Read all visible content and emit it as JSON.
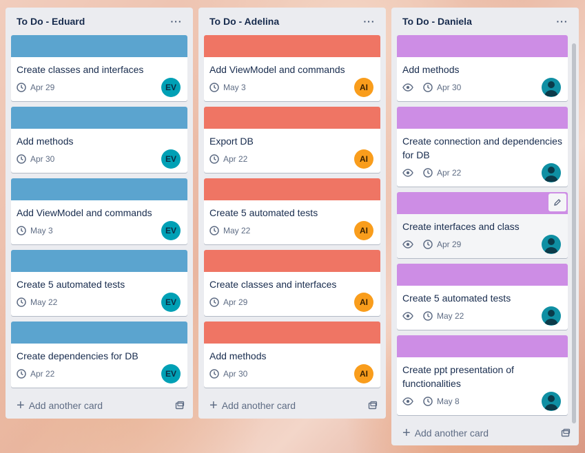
{
  "colors": {
    "blue": "#5ba4cf",
    "red": "#ef7564",
    "purple": "#cd8de5"
  },
  "lists": [
    {
      "title": "To Do - Eduard",
      "menu": "···",
      "add_card": "Add another card",
      "cards": [
        {
          "title": "Create classes and interfaces",
          "date": "Apr 29",
          "avatar": "EV"
        },
        {
          "title": "Add methods",
          "date": "Apr 30",
          "avatar": "EV"
        },
        {
          "title": "Add ViewModel and commands",
          "date": "May 3",
          "avatar": "EV"
        },
        {
          "title": "Create 5 automated tests",
          "date": "May 22",
          "avatar": "EV"
        },
        {
          "title": "Create dependencies for DB",
          "date": "Apr 22",
          "avatar": "EV"
        }
      ]
    },
    {
      "title": "To Do - Adelina",
      "menu": "···",
      "add_card": "Add another card",
      "cards": [
        {
          "title": "Add ViewModel and commands",
          "date": "May 3",
          "avatar": "AI"
        },
        {
          "title": "Export DB",
          "date": "Apr 22",
          "avatar": "AI"
        },
        {
          "title": "Create 5 automated tests",
          "date": "May 22",
          "avatar": "AI"
        },
        {
          "title": "Create classes and interfaces",
          "date": "Apr 29",
          "avatar": "AI"
        },
        {
          "title": "Add methods",
          "date": "Apr 30",
          "avatar": "AI"
        }
      ]
    },
    {
      "title": "To Do - Daniela",
      "menu": "···",
      "add_card": "Add another card",
      "cards": [
        {
          "title": "Add methods",
          "date": "Apr 30"
        },
        {
          "title": "Create connection and dependencies for DB",
          "date": "Apr 22"
        },
        {
          "title": "Create interfaces and class",
          "date": "Apr 29"
        },
        {
          "title": "Create 5 automated tests",
          "date": "May 22"
        },
        {
          "title": "Create ppt presentation of functionalities",
          "date": "May 8"
        }
      ]
    }
  ]
}
